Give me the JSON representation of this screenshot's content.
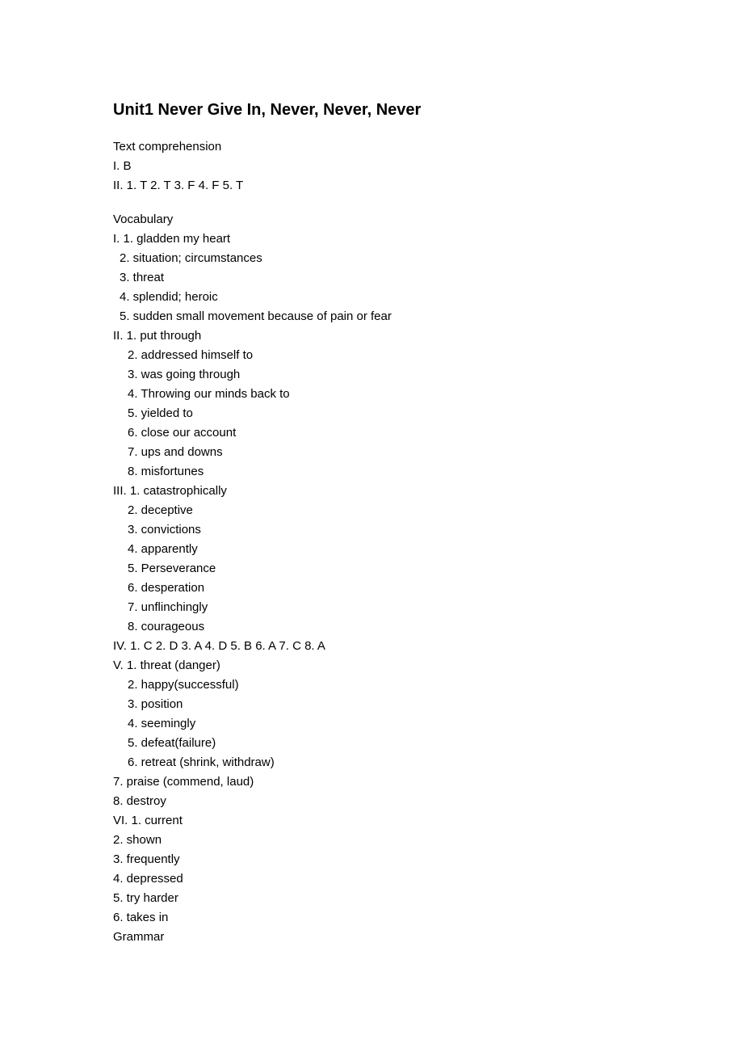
{
  "title": "Unit1 Never Give In, Never, Never, Never",
  "sections": {
    "textComprehension": {
      "heading": "Text comprehension",
      "lines": [
        "I. B",
        "II. 1. T 2. T 3. F 4. F 5. T"
      ]
    },
    "vocabulary": {
      "heading": "Vocabulary",
      "i": {
        "first": "I. 1. gladden my heart",
        "items": [
          "2. situation; circumstances",
          "3. threat",
          "4. splendid; heroic",
          "5. sudden small movement because of pain or fear"
        ]
      },
      "ii": {
        "first": "II. 1. put through",
        "items": [
          "2. addressed himself to",
          "3. was going through",
          "4. Throwing our minds back to",
          "5. yielded to",
          "6. close our account",
          "7. ups and downs",
          "8. misfortunes"
        ]
      },
      "iii": {
        "first": "III. 1. catastrophically",
        "items": [
          "2. deceptive",
          "3. convictions",
          "4. apparently",
          "5. Perseverance",
          "6. desperation",
          "7. unflinchingly",
          "8. courageous"
        ]
      },
      "iv": "IV. 1. C 2. D 3. A 4. D 5. B 6. A 7. C 8. A",
      "v": {
        "first": "V.  1. threat (danger)",
        "items": [
          "2. happy(successful)",
          "3. position",
          "4. seemingly",
          "5. defeat(failure)",
          "6. retreat (shrink, withdraw)"
        ],
        "flat": [
          "7. praise (commend, laud)",
          "8. destroy"
        ]
      },
      "vi": {
        "first": "VI. 1. current",
        "flat": [
          "2. shown",
          "3. frequently",
          "4. depressed",
          "5. try harder",
          "6. takes in"
        ]
      }
    },
    "grammar": {
      "heading": "Grammar"
    }
  }
}
